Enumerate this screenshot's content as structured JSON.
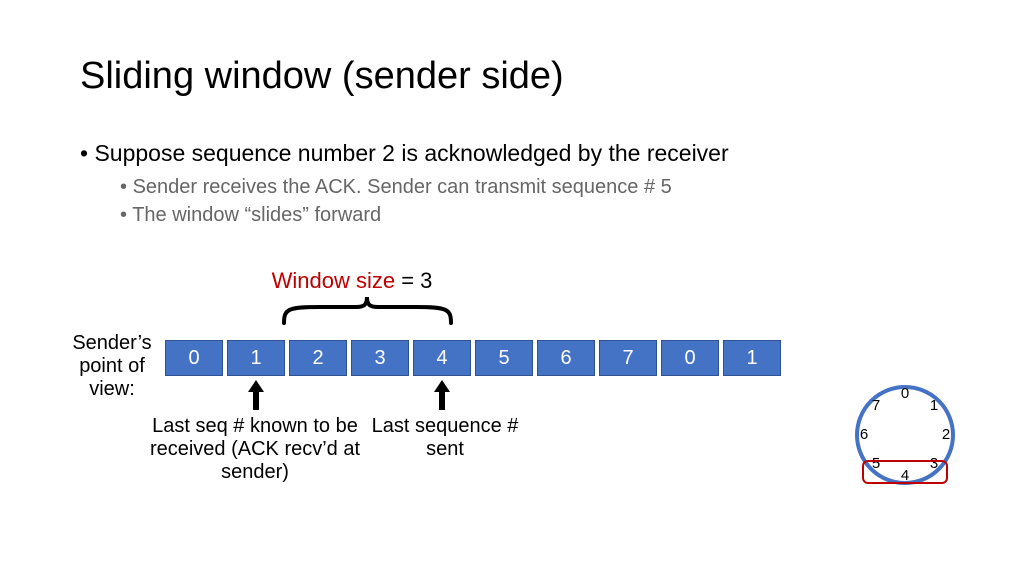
{
  "title": "Sliding window (sender side)",
  "bullets": {
    "main": "Suppose sequence number 2 is acknowledged by the receiver",
    "sub1": "Sender receives the ACK. Sender can transmit sequence # 5",
    "sub2": "The window “slides” forward"
  },
  "window_size": {
    "label": "Window size",
    "value": "= 3"
  },
  "sender_label": "Sender’s point of view:",
  "sequence_boxes": [
    "0",
    "1",
    "2",
    "3",
    "4",
    "5",
    "6",
    "7",
    "0",
    "1"
  ],
  "window_start_index": 2,
  "window_end_index": 4,
  "arrow_captions": {
    "last_ack": "Last seq # known to be received (ACK recv’d at sender)",
    "last_sent": "Last sequence # sent"
  },
  "arrow_positions": {
    "last_ack_index": 1,
    "last_sent_index": 4
  },
  "clock": {
    "numbers": [
      "0",
      "1",
      "2",
      "3",
      "4",
      "5",
      "6",
      "7"
    ],
    "highlight_from": 3,
    "highlight_to": 5
  },
  "chart_data": {
    "type": "table",
    "title": "Sliding window sender state",
    "sequence": [
      0,
      1,
      2,
      3,
      4,
      5,
      6,
      7,
      0,
      1
    ],
    "window_size": 3,
    "last_ack_received_seq": 1,
    "last_sent_seq": 4,
    "window_seqs": [
      2,
      3,
      4
    ],
    "modulus": 8,
    "clock_highlight": [
      3,
      4,
      5
    ]
  }
}
